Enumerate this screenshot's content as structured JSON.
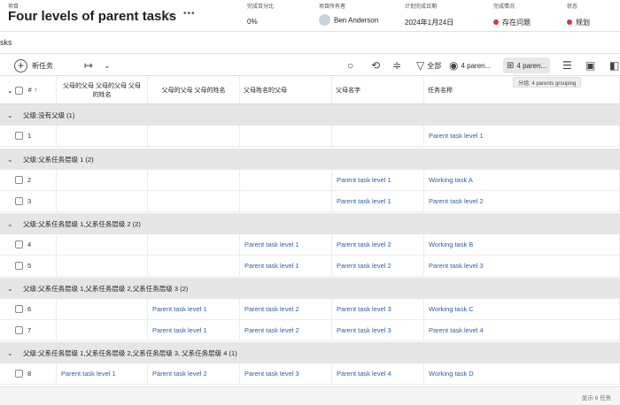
{
  "header": {
    "project_label": "项目",
    "title": "Four levels of parent tasks",
    "percent_label": "完成百分比",
    "percent_value": "0%",
    "owner_label": "项目所有者",
    "owner_value": "Ben Anderson",
    "due_label": "计划完成日期",
    "due_value": "2024年1月24日",
    "condition_label": "完成情况",
    "condition_value": "存在问题",
    "status_label": "状态",
    "status_value": "规划",
    "status_color": "#d7373f"
  },
  "tab_text": "sks",
  "toolbar": {
    "new_task": "新任务",
    "filter_label": "全部",
    "view_label": "4 paren...",
    "grouping_label": "4 paren...",
    "tooltip": "分组: 4 parents grouping"
  },
  "columns": {
    "number": "#",
    "col1": "父母的父母 父母的父母 父母的姓名",
    "col2": "父母的父母 父母的姓名",
    "col3": "父母姓名的父母",
    "col4": "父母名字",
    "col5": "任务名称"
  },
  "groups": [
    {
      "label": "父级:没有父级 (1)"
    },
    {
      "label": "父级:父系任务层级 1 (2)"
    },
    {
      "label": "父级:父系任务层级 1,父系任务层级 2 (2)"
    },
    {
      "label": "父级:父系任务层级 1,父系任务层级 2,父系任务层级 3 (2)"
    },
    {
      "label": "父级:父系任务层级 1,父系任务层级 2,父系任务层级 3, 父系任务层级 4 (1)"
    }
  ],
  "rows": [
    {
      "num": "1",
      "c1": "",
      "c2": "",
      "c3": "",
      "c4": "",
      "c5": "Parent task level 1"
    },
    {
      "num": "2",
      "c1": "",
      "c2": "",
      "c3": "",
      "c4": "Parent task level 1",
      "c5": "Working task A"
    },
    {
      "num": "3",
      "c1": "",
      "c2": "",
      "c3": "",
      "c4": "Parent task level 1",
      "c5": "Parent task level 2"
    },
    {
      "num": "4",
      "c1": "",
      "c2": "",
      "c3": "Parent task level 1",
      "c4": "Parent task level 2",
      "c5": "Working task B"
    },
    {
      "num": "5",
      "c1": "",
      "c2": "",
      "c3": "Parent task level 1",
      "c4": "Parent task level 2",
      "c5": "Parent task level 3"
    },
    {
      "num": "6",
      "c1": "",
      "c2": "Parent task level 1",
      "c3": "Parent task level 2",
      "c4": "Parent task level 3",
      "c5": "Working task C"
    },
    {
      "num": "7",
      "c1": "",
      "c2": "Parent task level 1",
      "c3": "Parent task level 2",
      "c4": "Parent task level 3",
      "c5": "Parent task level 4"
    },
    {
      "num": "8",
      "c1": "Parent task level 1",
      "c2": "Parent task level 2",
      "c3": "Parent task level 3",
      "c4": "Parent task level 4",
      "c5": "Working task D"
    }
  ],
  "footer": {
    "count": "显示 6 任务"
  }
}
